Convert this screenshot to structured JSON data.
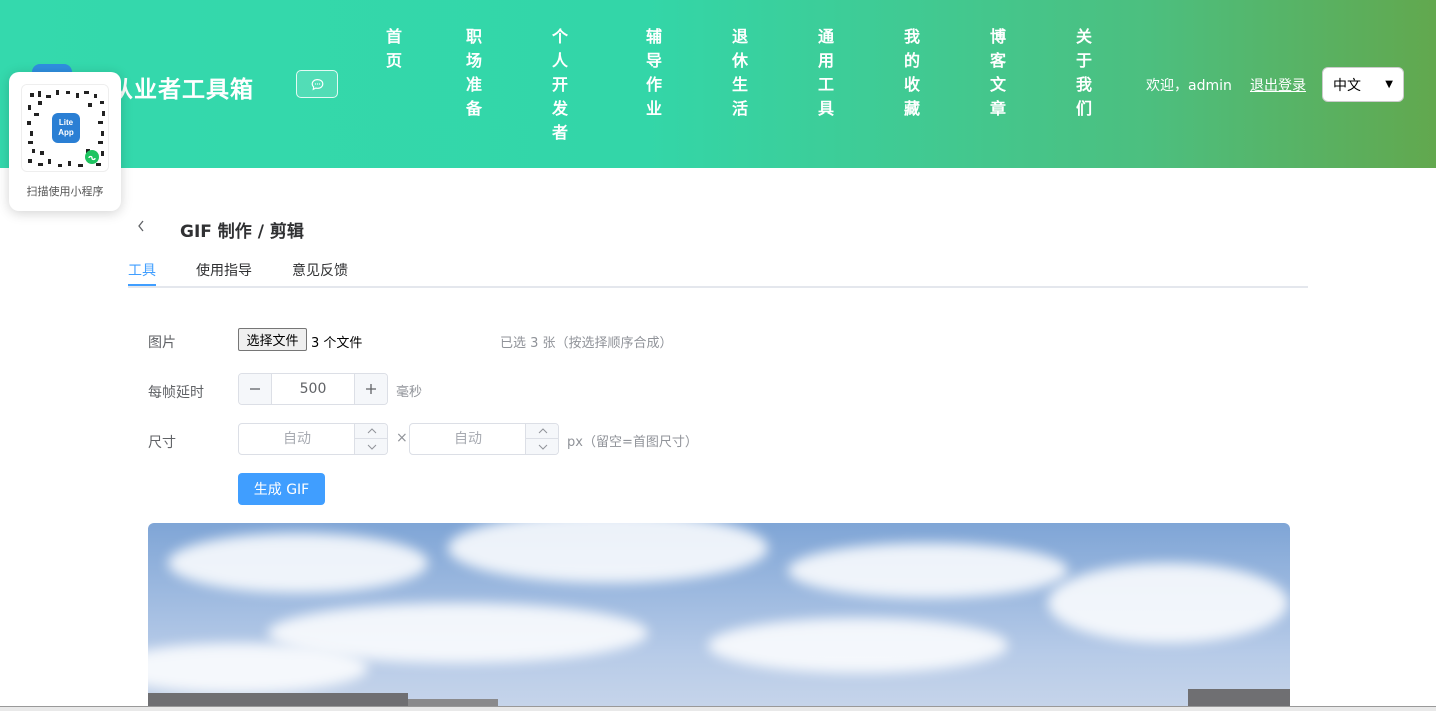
{
  "header": {
    "brand_title": "件从业者工具箱",
    "nav": [
      "首页",
      "职场准备",
      "个人开发者",
      "辅导作业",
      "退休生活",
      "通用工具",
      "我的收藏",
      "博客文章",
      "关于我们"
    ],
    "welcome": "欢迎，admin",
    "logout": "退出登录",
    "language": "中文"
  },
  "qr_popup": {
    "caption": "扫描使用小程序",
    "logo_text_1": "Lite",
    "logo_text_2": "App"
  },
  "page": {
    "title": "GIF 制作 / 剪辑",
    "tabs": [
      "工具",
      "使用指导",
      "意见反馈"
    ],
    "active_tab": 0
  },
  "form": {
    "image_label": "图片",
    "file_button": "选择文件",
    "file_count": "3 个文件",
    "selected_hint": "已选 3 张（按选择顺序合成）",
    "delay_label": "每帧延时",
    "delay_value": "500",
    "delay_unit": "毫秒",
    "size_label": "尺寸",
    "width_placeholder": "自动",
    "height_placeholder": "自动",
    "times": "×",
    "size_hint": "px（留空=首图尺寸）",
    "generate_button": "生成 GIF"
  },
  "colors": {
    "header_gradient_start": "#34d9ad",
    "header_gradient_end": "#62a84e",
    "accent": "#409eff"
  },
  "icons": {
    "chat": "chat-bubble-icon",
    "back": "chevron-left-icon",
    "minus": "minus-icon",
    "plus": "plus-icon",
    "spin_up": "chevron-up-icon",
    "spin_down": "chevron-down-icon"
  }
}
